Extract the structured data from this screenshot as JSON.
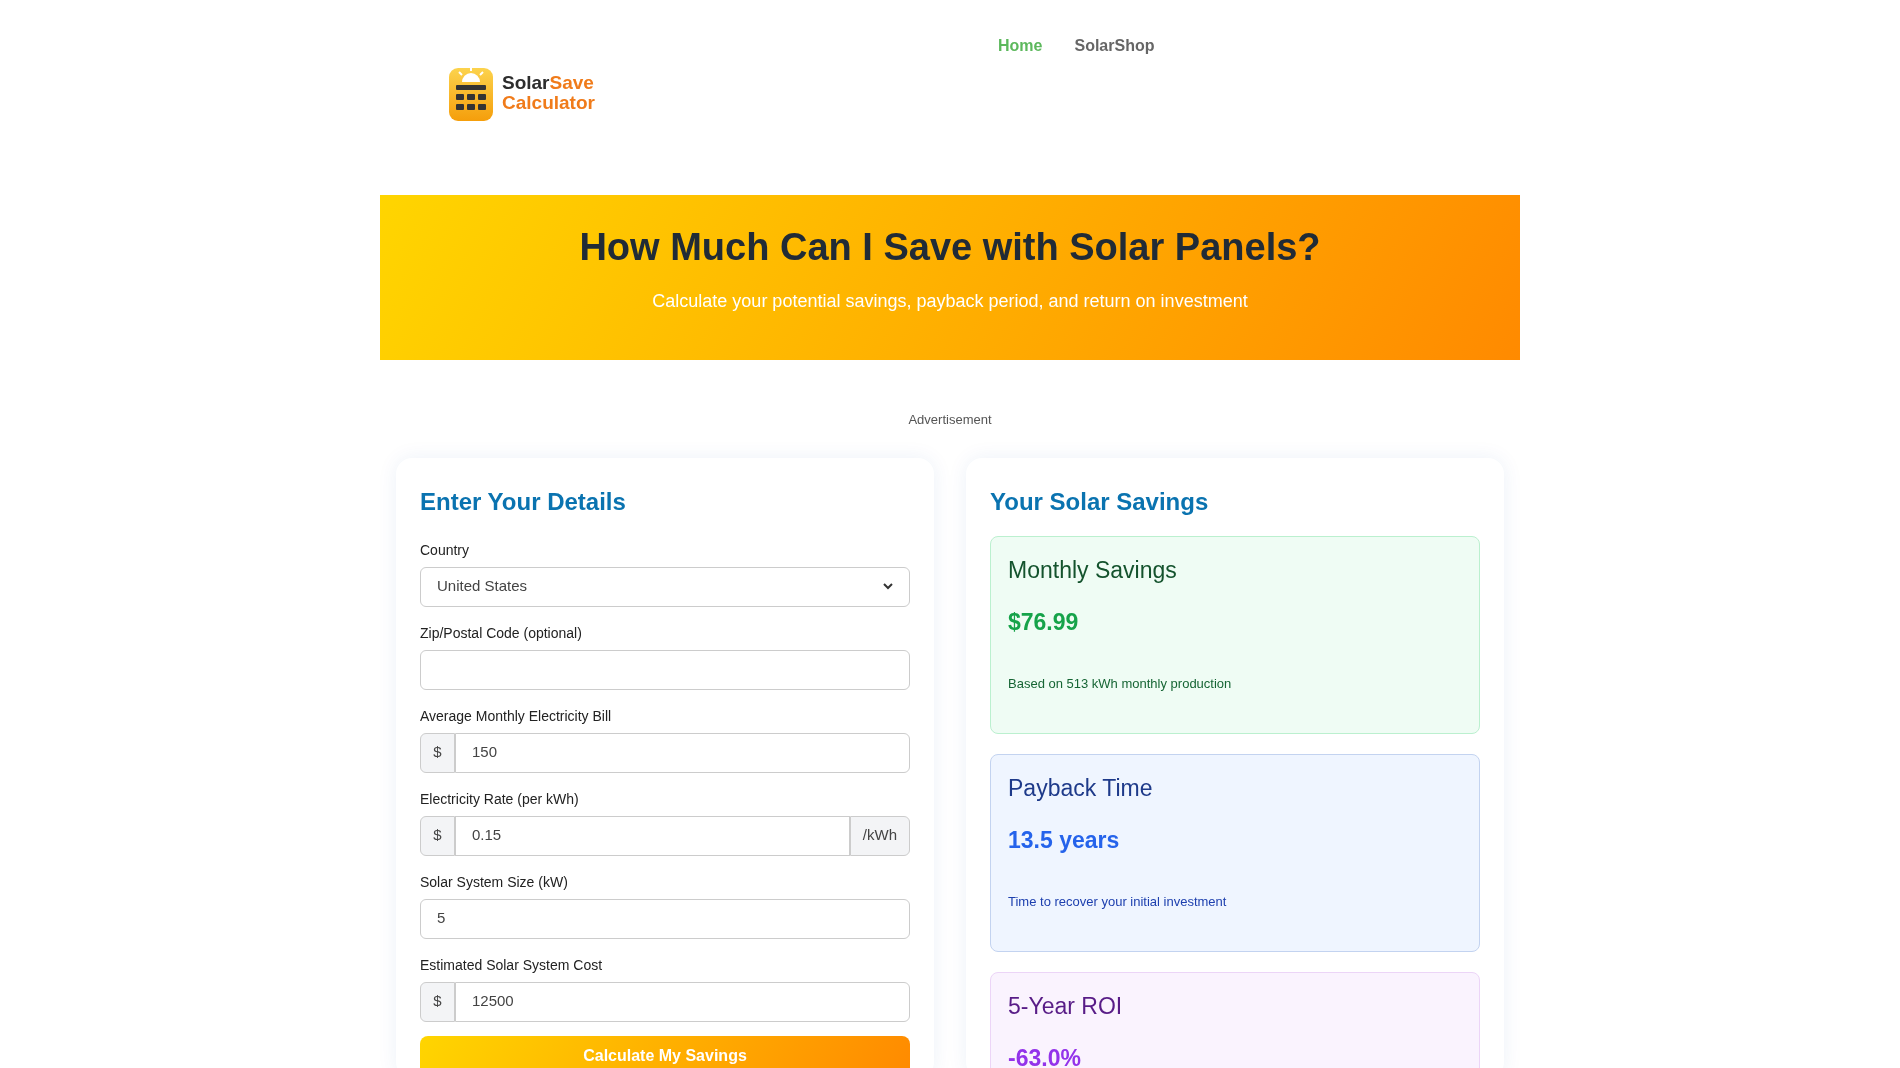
{
  "logo": {
    "word_1": "Solar",
    "word_2": "Save",
    "word_3": "Calculator"
  },
  "nav": [
    {
      "label": "Home",
      "selected": true
    },
    {
      "label": "SolarShop",
      "selected": false
    }
  ],
  "hero": {
    "title": "How Much Can I Save with Solar Panels?",
    "subtitle": "Calculate your potential savings, payback period, and return on investment"
  },
  "ad_label": "Advertisement",
  "form": {
    "title": "Enter Your Details",
    "fields": [
      {
        "kind": "select",
        "label": "Country",
        "value": "United States"
      },
      {
        "kind": "text",
        "label": "Zip/Postal Code (optional)"
      },
      {
        "kind": "text",
        "label": "Average Monthly Electricity Bill",
        "prefix": "$",
        "value": "150"
      },
      {
        "kind": "text",
        "label": "Electricity Rate (per kWh)",
        "prefix": "$",
        "value": "0.15",
        "suffix": "/kWh"
      },
      {
        "kind": "text",
        "label": "Solar System Size (kW)",
        "value": "5"
      },
      {
        "kind": "text",
        "label": "Estimated Solar System Cost",
        "prefix": "$",
        "value": "12500"
      }
    ],
    "button": "Calculate My Savings"
  },
  "results": {
    "title": "Your Solar Savings",
    "cards": [
      {
        "kind": "green",
        "title": "Monthly Savings",
        "value": "$76.99",
        "note": "Based on 513 kWh monthly production"
      },
      {
        "kind": "blue",
        "title": "Payback Time",
        "value": "13.5 years",
        "note": "Time to recover your initial investment"
      },
      {
        "kind": "purple",
        "title": "5-Year ROI",
        "value": "-63.0%"
      }
    ]
  }
}
